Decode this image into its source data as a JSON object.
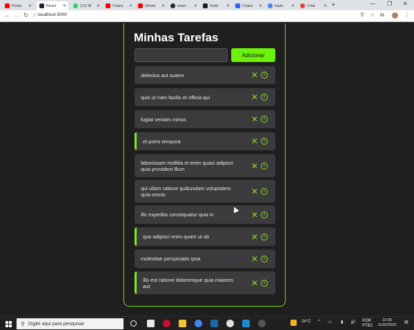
{
  "browser": {
    "tabs": [
      {
        "label": "Ponto",
        "color": "#ff0000"
      },
      {
        "label": "React",
        "color": "#20232a"
      },
      {
        "label": "(13) W",
        "color": "#25d366"
      },
      {
        "label": "Crianc",
        "color": "#ff0000"
      },
      {
        "label": "Simeo",
        "color": "#ff0000"
      },
      {
        "label": "react",
        "color": "#24292e"
      },
      {
        "label": "Subir",
        "color": "#1b1f24"
      },
      {
        "label": "Crianc",
        "color": "#2962ff"
      },
      {
        "label": "tradu",
        "color": "#4285f4"
      },
      {
        "label": "Criar",
        "color": "#ea4335"
      }
    ],
    "url": "localhost:3000"
  },
  "app": {
    "title": "Minhas Tarefas",
    "input": {
      "value": "",
      "placeholder": ""
    },
    "add_label": "Adicionar",
    "accent": "#6cf10a",
    "tasks": [
      {
        "text": "delectus aut autem",
        "completed": false
      },
      {
        "text": "quis ut nam facilis et officia qui",
        "completed": false
      },
      {
        "text": "fugiat veniam minus",
        "completed": false
      },
      {
        "text": "et porro tempora",
        "completed": true
      },
      {
        "text": "laboriosam mollitia et enim quasi adipisci quia provident illum",
        "completed": false
      },
      {
        "text": "qui ullam ratione quibusdam voluptatem quia omnis",
        "completed": false
      },
      {
        "text": "illo expedita consequatur quia in",
        "completed": false
      },
      {
        "text": "quo adipisci enim quam ut ab",
        "completed": true
      },
      {
        "text": "molestiae perspiciatis ipsa",
        "completed": false
      },
      {
        "text": "illo est ratione doloremque quia maiores aut",
        "completed": true
      }
    ]
  },
  "taskbar": {
    "search_placeholder": "Digite aqui para pesquisar",
    "temperature": "24°C",
    "lang_line1": "POR",
    "lang_line2": "PTB2",
    "time": "22:05",
    "date": "11/02/2022"
  }
}
